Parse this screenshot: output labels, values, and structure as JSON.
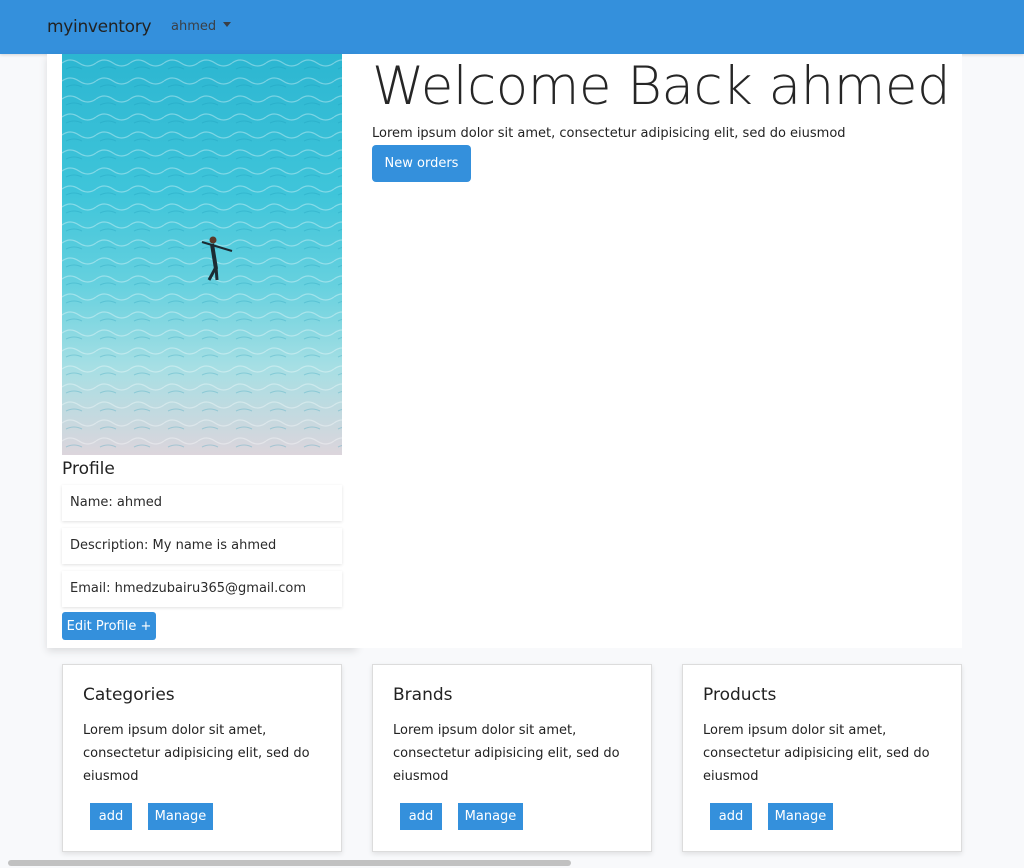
{
  "navbar": {
    "brand": "myinventory",
    "user_menu": "ahmed",
    "background": "#3490dc"
  },
  "profile": {
    "photo_alt": "",
    "title": "Profile",
    "name": "Name: ahmed",
    "description": "Description: My name is ahmed",
    "email": "Email: hmedzubairu365@gmail.com",
    "edit_button": "Edit Profile +"
  },
  "welcome": {
    "title": "Welcome Back ahmed",
    "text": "Lorem ipsum dolor sit amet, consectetur adipisicing elit, sed do eiusmod",
    "orders_button": "New orders"
  },
  "cards": [
    {
      "title": "Categories",
      "text": "Lorem ipsum dolor sit amet, consectetur adipisicing elit, sed do eiusmod",
      "add_label": "add",
      "manage_label": "Manage"
    },
    {
      "title": "Brands",
      "text": "Lorem ipsum dolor sit amet, consectetur adipisicing elit, sed do eiusmod",
      "add_label": "add",
      "manage_label": "Manage"
    },
    {
      "title": "Products",
      "text": "Lorem ipsum dolor sit amet, consectetur adipisicing elit, sed do eiusmod",
      "add_label": "add",
      "manage_label": "Manage"
    }
  ],
  "colors": {
    "primary": "#3490dc",
    "page_background": "#f8f9fb"
  }
}
